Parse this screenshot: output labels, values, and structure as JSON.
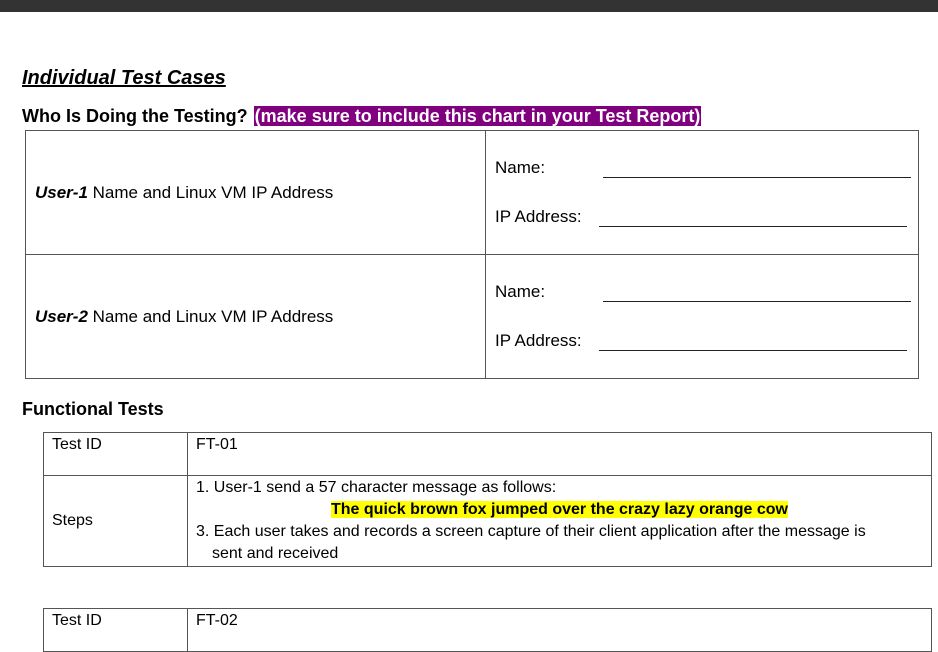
{
  "heading": "Individual Test Cases",
  "who_section": {
    "title": "Who Is Doing the Testing?",
    "note": "(make sure to include this chart in your Test Report)"
  },
  "users": [
    {
      "user": "User-1",
      "desc": " Name and Linux VM IP Address",
      "name_label": "Name:",
      "ip_label": "IP Address:"
    },
    {
      "user": "User-2",
      "desc": " Name and Linux VM IP Address",
      "name_label": "Name:",
      "ip_label": "IP Address:"
    }
  ],
  "functional_title": "Functional Tests",
  "tests": [
    {
      "id_label": "Test ID",
      "id": "FT-01",
      "steps_label": "Steps",
      "step1": "1. User-1 send a 57 character message as follows:",
      "message": "The quick brown fox jumped over the crazy lazy orange cow",
      "step3": "3. Each user takes and records a screen capture of their client application after the message is",
      "step3_cont": "sent and received"
    },
    {
      "id_label": "Test ID",
      "id": "FT-02"
    }
  ],
  "colors": {
    "topbar": "#333333",
    "note_bg": "#800080",
    "highlight": "#ffff00"
  }
}
